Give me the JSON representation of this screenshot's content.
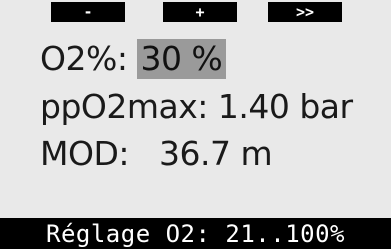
{
  "softkeys": {
    "minus_label": "-",
    "plus_label": "+",
    "next_label": ">>"
  },
  "settings": {
    "o2_label": "O2%:",
    "o2_value": "30 %",
    "ppo2_label": "ppO2max:",
    "ppo2_value": "1.40 bar",
    "mod_label": "MOD:",
    "mod_value": "36.7 m"
  },
  "status": {
    "text": "Réglage O2: 21..100%"
  },
  "colors": {
    "background": "#e9e9e9",
    "softkey_bg": "#000000",
    "highlight": "#9a9a9a",
    "text": "#1a1a1a"
  }
}
